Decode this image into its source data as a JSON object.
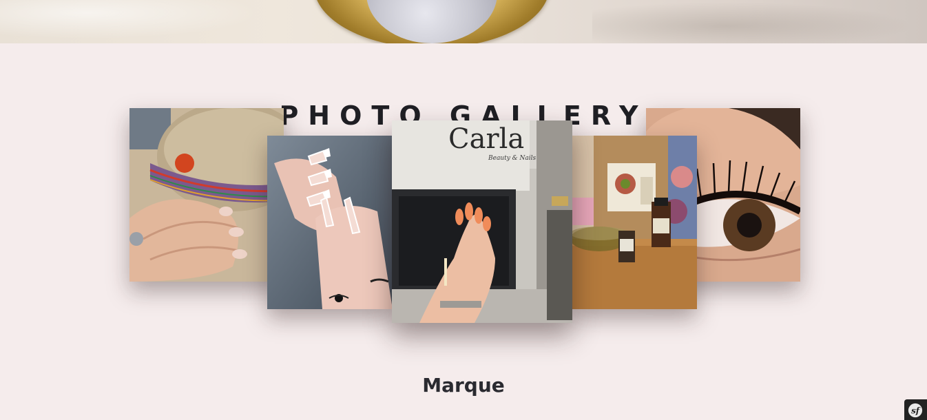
{
  "gallery": {
    "title": "PHOTO GALLERY",
    "photos": [
      {
        "name": "nails-hat-photo"
      },
      {
        "name": "french-nails-photo"
      },
      {
        "name": "carla-salon-storefront-photo",
        "sign_text": "Carla",
        "sign_subtext": "Beauty & Nails"
      },
      {
        "name": "skincare-products-photo"
      },
      {
        "name": "eyelash-extensions-photo"
      }
    ]
  },
  "brand": {
    "heading": "Marque"
  },
  "toolbar": {
    "icon": "symfony-icon"
  },
  "colors": {
    "background": "#f5ecec",
    "title": "#1f1f24",
    "toolbar": "#222222"
  }
}
